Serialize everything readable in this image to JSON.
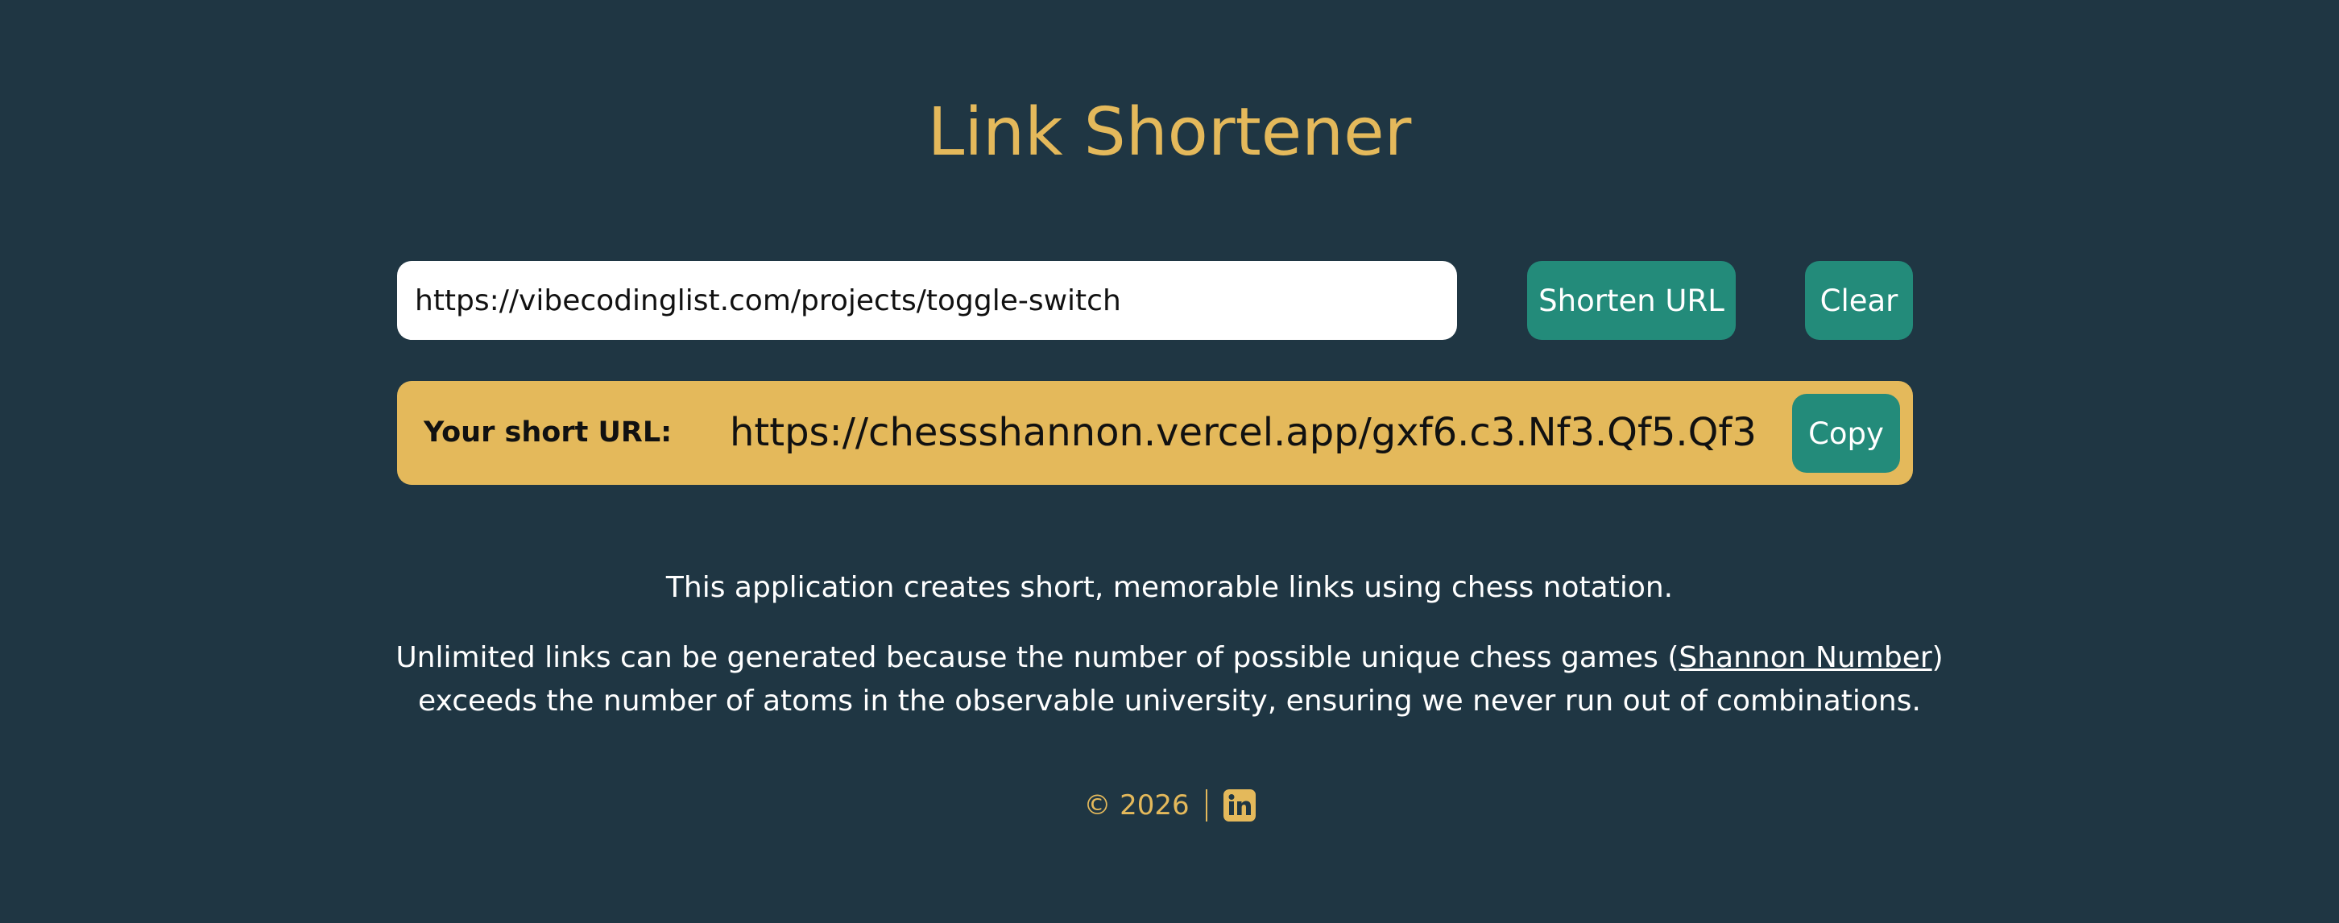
{
  "header": {
    "title": "Link Shortener"
  },
  "form": {
    "url_value": "https://vibecodinglist.com/projects/toggle-switch",
    "shorten_label": "Shorten URL",
    "clear_label": "Clear"
  },
  "result": {
    "label": "Your short URL:",
    "short_url": "https://chessshannon.vercel.app/gxf6.c3.Nf3.Qf5.Qf3",
    "copy_label": "Copy"
  },
  "description": {
    "line1": "This application creates short, memorable links using chess notation.",
    "para2_before": "Unlimited links can be generated because the number of possible unique chess games (",
    "para2_link": "Shannon Number",
    "para2_after_paren": ")",
    "para2_line2": "exceeds the number of atoms in the observable university, ensuring we never run out of combinations."
  },
  "footer": {
    "copyright": "© 2026",
    "social_icon": "linkedin-icon"
  },
  "colors": {
    "background": "#1f3643",
    "accent": "#e4b95b",
    "button": "#238b7a",
    "text": "#ffffff"
  }
}
